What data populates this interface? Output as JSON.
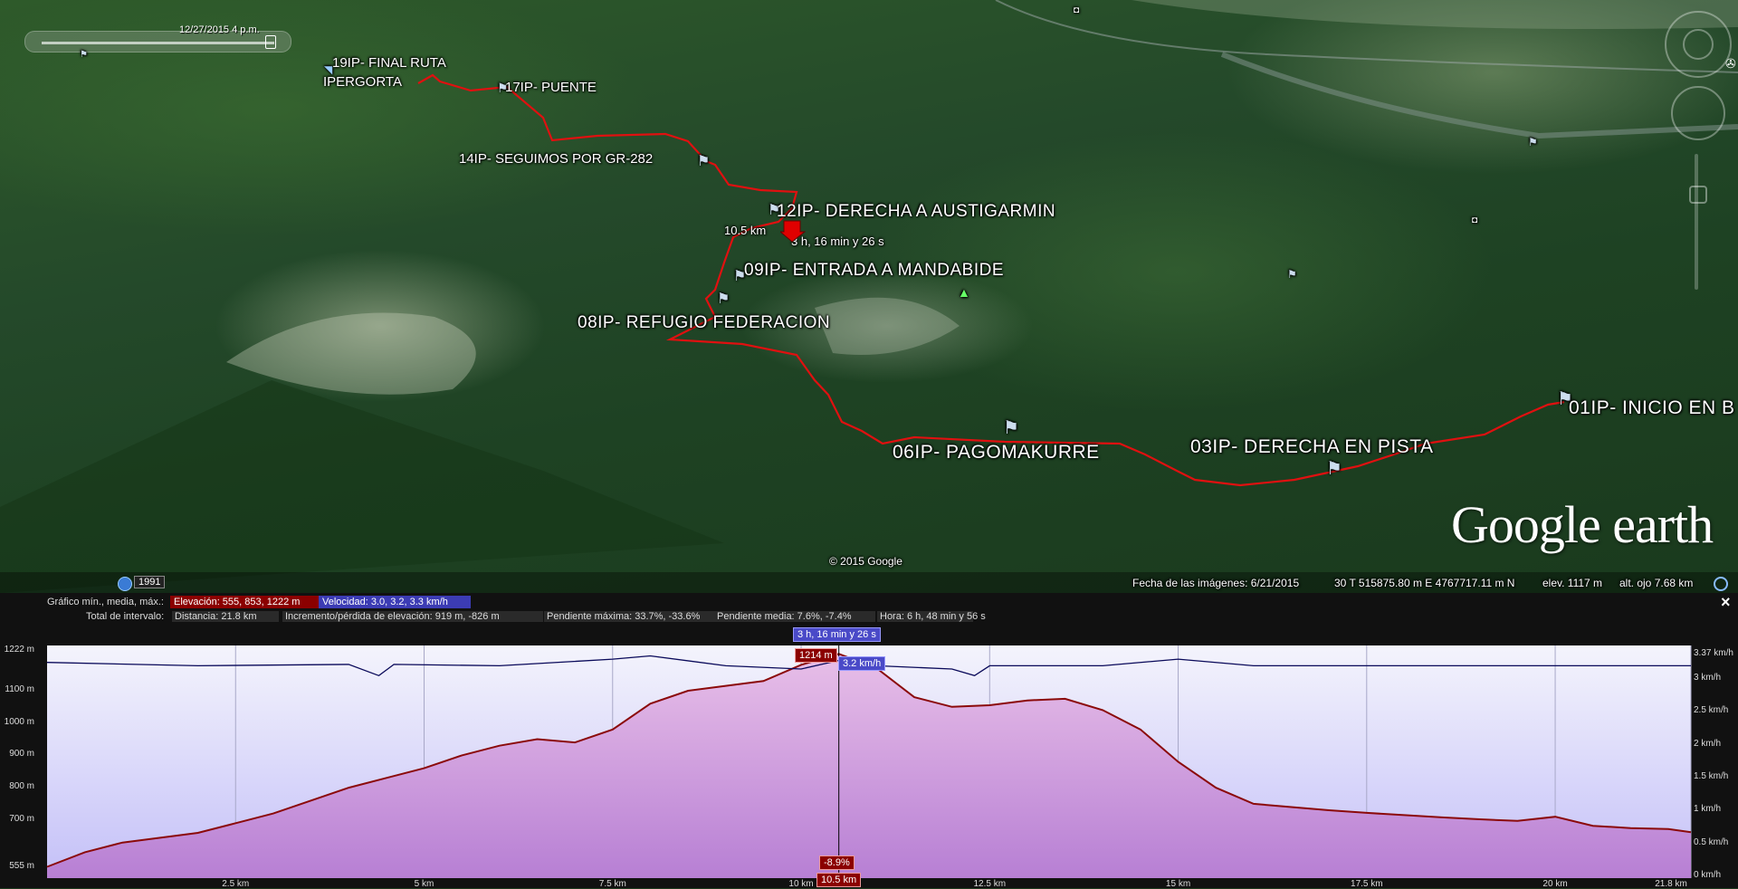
{
  "timeslider": {
    "label": "12/27/2015    4 p.m."
  },
  "map_labels": {
    "wp19": "19IP- FINAL RUTA",
    "wp19b": "IPERGORTA",
    "wp17": "17IP- PUENTE",
    "wp14": "14IP- SEGUIMOS POR GR-282",
    "wp12": "12IP- DERECHA A AUSTIGARMIN",
    "cursor_dist": "10.5 km",
    "cursor_time": "3 h, 16 min y 26 s",
    "wp09": "09IP- ENTRADA A MANDABIDE",
    "wp08": "08IP- REFUGIO FEDERACION",
    "wp06": "06IP- PAGOMAKURRE",
    "wp03": "03IP- DERECHA EN PISTA",
    "wp01": "01IP- INICIO EN B"
  },
  "brand": {
    "logo_text": "Google earth"
  },
  "copyright": "© 2015 Google",
  "historical_year": "1991",
  "status_bar": {
    "imagery_date": "Fecha de las imágenes: 6/21/2015",
    "coords": "30 T 515875.80 m E 4767717.11 m N",
    "elev": "elev.  1117 m",
    "eye_alt": "alt. ojo    7.68 km"
  },
  "profile": {
    "close_icon": "×",
    "graph_label": "Gráfico  mín., media, máx.:",
    "elevation_chip": "Elevación: 555, 853, 1222 m",
    "speed_chip": "Velocidad: 3.0, 3.2, 3.3 km/h",
    "interval_label": "Total de intervalo:",
    "distance": "Distancia: 21.8 km",
    "gain_loss": "Incremento/pérdida de elevación: 919 m, -826 m",
    "max_slope": "Pendiente máxima: 33.7%, -33.6%",
    "avg_slope": "Pendiente media: 7.6%, -7.4%",
    "duration": "Hora: 6 h, 48 min y 56 s",
    "cursor_time_box": "3 h, 16 min y 26 s",
    "cursor_elev_box": "1214 m",
    "cursor_speed_box": "3.2 km/h",
    "cursor_slope_box": "-8.9%",
    "cursor_dist_box": "10.5 km"
  },
  "chart_data": {
    "type": "line",
    "title": "",
    "xlabel": "",
    "ylabel": "",
    "x_unit": "km",
    "xlim": [
      0,
      21.8
    ],
    "y_left_ticks": [
      "555 m",
      "700 m",
      "800 m",
      "900 m",
      "1000 m",
      "1100 m",
      "1222 m"
    ],
    "y_left_values": [
      555,
      700,
      800,
      900,
      1000,
      1100,
      1222
    ],
    "ylim_left": [
      520,
      1240
    ],
    "y_right_ticks": [
      "0 km/h",
      "0.5 km/h",
      "1 km/h",
      "1.5 km/h",
      "2 km/h",
      "2.5 km/h",
      "3 km/h",
      "3.37 km/h"
    ],
    "y_right_values": [
      0,
      0.5,
      1,
      1.5,
      2,
      2.5,
      3,
      3.37
    ],
    "x_ticks": [
      "2.5 km",
      "5 km",
      "7.5 km",
      "10 km",
      "12.5 km",
      "15 km",
      "17.5 km",
      "20 km",
      "21.8 km"
    ],
    "x_tick_values": [
      2.5,
      5,
      7.5,
      10,
      12.5,
      15,
      17.5,
      20,
      21.8
    ],
    "cursor_x": 10.5,
    "series": [
      {
        "name": "Elevación",
        "axis": "left",
        "color": "#8b0a0a",
        "x": [
          0,
          0.5,
          1,
          1.5,
          2,
          2.5,
          3,
          3.5,
          4,
          4.5,
          5,
          5.5,
          6,
          6.5,
          7,
          7.5,
          8,
          8.5,
          9,
          9.5,
          10,
          10.5,
          11,
          11.5,
          12,
          12.5,
          13,
          13.5,
          14,
          14.5,
          15,
          15.5,
          16,
          16.5,
          17,
          17.5,
          18,
          18.5,
          19,
          19.5,
          20,
          20.5,
          21,
          21.5,
          21.8
        ],
        "y": [
          555,
          600,
          630,
          645,
          660,
          690,
          720,
          760,
          800,
          830,
          860,
          900,
          930,
          950,
          940,
          980,
          1060,
          1100,
          1115,
          1130,
          1180,
          1214,
          1170,
          1080,
          1050,
          1055,
          1070,
          1075,
          1040,
          980,
          880,
          800,
          750,
          740,
          730,
          722,
          715,
          708,
          702,
          697,
          710,
          682,
          675,
          672,
          662
        ]
      },
      {
        "name": "Velocidad",
        "axis": "right",
        "color": "#0a0a5a",
        "x": [
          0,
          2,
          4,
          4.4,
          4.6,
          6,
          7.5,
          8,
          9,
          10,
          10.5,
          11,
          12,
          12.3,
          12.5,
          14,
          15,
          16,
          18,
          20,
          21.8
        ],
        "y": [
          3.25,
          3.2,
          3.22,
          3.05,
          3.22,
          3.2,
          3.3,
          3.35,
          3.2,
          3.15,
          3.28,
          3.2,
          3.15,
          3.05,
          3.2,
          3.2,
          3.3,
          3.2,
          3.2,
          3.2,
          3.2
        ]
      }
    ]
  }
}
